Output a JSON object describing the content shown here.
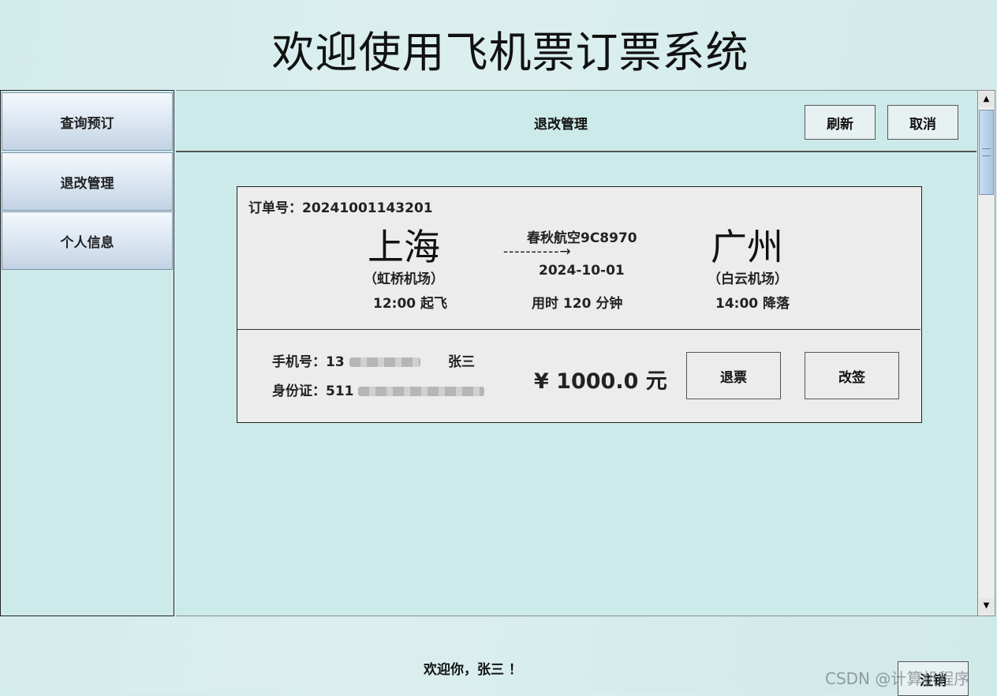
{
  "app_title": "欢迎使用飞机票订票系统",
  "sidebar": {
    "items": [
      {
        "label": "查询预订"
      },
      {
        "label": "退改管理"
      },
      {
        "label": "个人信息"
      }
    ]
  },
  "toolbar": {
    "title": "退改管理",
    "refresh_label": "刷新",
    "cancel_label": "取消"
  },
  "ticket": {
    "order_label": "订单号：",
    "order_no": "20241001143201",
    "departure": {
      "city": "上海",
      "airport": "（虹桥机场）",
      "time": "12:00 起飞"
    },
    "flight": {
      "airline_flight": "春秋航空9C8970",
      "arrow": "----------→",
      "date": "2024-10-01",
      "duration": "用时 120 分钟"
    },
    "arrival": {
      "city": "广州",
      "airport": "（白云机场）",
      "time": "14:00 降落"
    },
    "phone_label": "手机号：",
    "phone_visible": "13",
    "passenger_name": "张三",
    "id_label": "身份证：",
    "id_visible": "511",
    "price": "¥ 1000.0 元",
    "refund_label": "退票",
    "change_label": "改签"
  },
  "footer": {
    "welcome": "欢迎你，张三 ！",
    "logout_label": "注销",
    "watermark": "CSDN @计算机程序"
  }
}
